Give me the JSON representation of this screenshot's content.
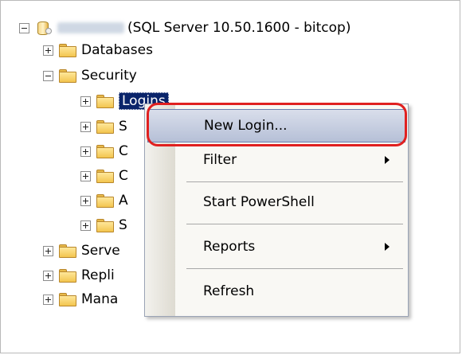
{
  "tree": {
    "server": {
      "suffix": "(SQL Server 10.50.1600 - bitcop)"
    },
    "databases": "Databases",
    "security": "Security",
    "logins": "Logins",
    "sec_children": [
      "S",
      "C",
      "C",
      "A",
      "S"
    ],
    "server_objects": "Serve",
    "replication": "Repli",
    "management": "Mana"
  },
  "context_menu": {
    "items": [
      "New Login...",
      "Filter",
      "Start PowerShell",
      "Reports",
      "Refresh"
    ]
  },
  "colors": {
    "highlight_ring": "#e02020",
    "selection": "#0a246a"
  }
}
